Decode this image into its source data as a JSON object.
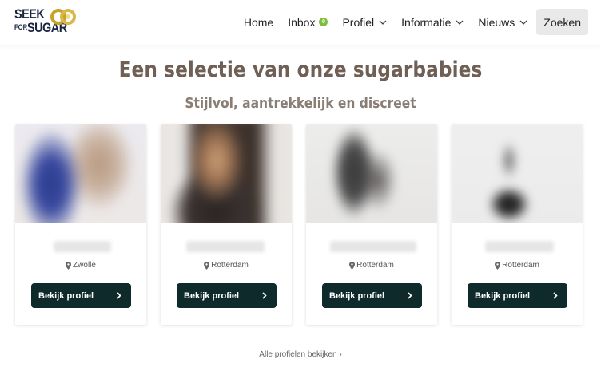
{
  "header": {
    "logo": {
      "line1": "SEEK",
      "line2": "FOR",
      "line3": "SUGAR"
    },
    "nav": [
      {
        "label": "Home",
        "dropdown": false
      },
      {
        "label": "Inbox",
        "dropdown": false,
        "badge": "0"
      },
      {
        "label": "Profiel",
        "dropdown": true
      },
      {
        "label": "Informatie",
        "dropdown": true
      },
      {
        "label": "Nieuws",
        "dropdown": true
      }
    ],
    "search_label": "Zoeken"
  },
  "main": {
    "title": "Een selectie van onze sugarbabies",
    "subtitle": "Stijlvol, aantrekkelijk en discreet",
    "profiles": [
      {
        "location": "Zwolle",
        "button": "Bekijk profiel"
      },
      {
        "location": "Rotterdam",
        "button": "Bekijk profiel"
      },
      {
        "location": "Rotterdam",
        "button": "Bekijk profiel"
      },
      {
        "location": "Rotterdam",
        "button": "Bekijk profiel"
      }
    ],
    "all_profiles_link": "Alle profielen bekijken ›"
  },
  "colors": {
    "brand_dark": "#1a2440",
    "brand_gold": "#c9a227",
    "button_bg": "#0e2a2b",
    "badge": "#7cbf3f",
    "title": "#6f5f55"
  },
  "icons": [
    "location-pin-icon",
    "chevron-right-icon",
    "chevron-down-icon",
    "gold-rings-logo-icon"
  ]
}
